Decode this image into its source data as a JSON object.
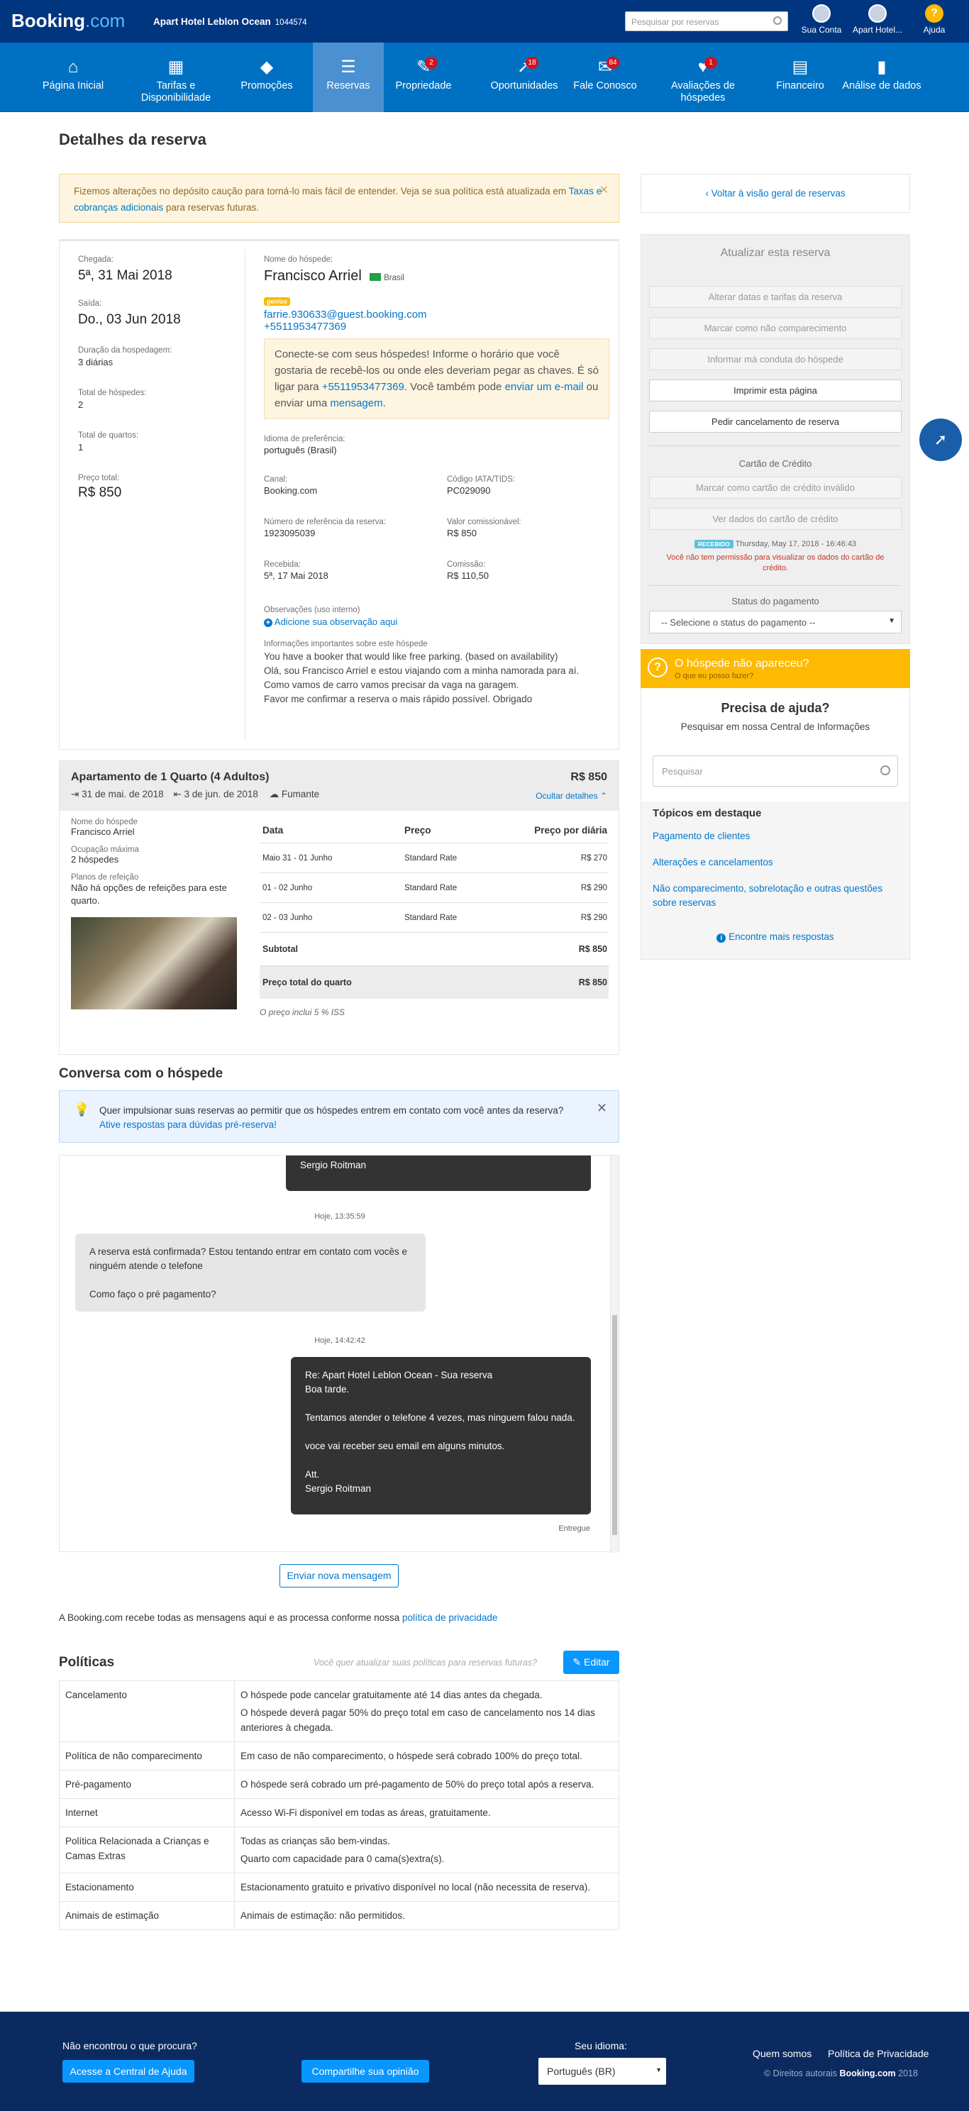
{
  "header": {
    "logo_main": "Booking",
    "logo_suffix": ".com",
    "hotel_name": "Apart Hotel Leblon Ocean",
    "hotel_id": "1044574",
    "search_placeholder": "Pesquisar por reservas",
    "account_label": "Sua Conta",
    "property_label": "Apart Hotel...",
    "help_label": "Ajuda"
  },
  "nav": [
    {
      "label": "Página Inicial",
      "icon": "home-icon",
      "badge": ""
    },
    {
      "label": "Tarifas e Disponibilidade",
      "icon": "calendar-icon",
      "badge": ""
    },
    {
      "label": "Promoções",
      "icon": "tag-icon",
      "badge": ""
    },
    {
      "label": "Reservas",
      "icon": "list-icon",
      "badge": ""
    },
    {
      "label": "Propriedade",
      "icon": "pen-icon",
      "badge": "2"
    },
    {
      "label": "Oportunidades",
      "icon": "rocket-icon",
      "badge": "18"
    },
    {
      "label": "Fale Conosco",
      "icon": "envelope-icon",
      "badge": "84"
    },
    {
      "label": "Avaliações de hóspedes",
      "icon": "heart-icon",
      "badge": "1"
    },
    {
      "label": "Financeiro",
      "icon": "document-icon",
      "badge": ""
    },
    {
      "label": "Análise de dados",
      "icon": "chart-icon",
      "badge": ""
    }
  ],
  "page": {
    "title": "Detalhes da reserva"
  },
  "alert": {
    "text1": "Fizemos alterações no depósito caução para torná-lo mais fácil de entender. Veja se sua política está atualizada em ",
    "link": "Taxas e cobranças adicionais",
    "text2": " para reservas futuras."
  },
  "summary": {
    "checkin_label": "Chegada:",
    "checkin": "5ª, 31 Mai 2018",
    "checkout_label": "Saída:",
    "checkout": "Do., 03 Jun 2018",
    "duration_label": "Duração da hospedagem:",
    "duration": "3 diárias",
    "guests_label": "Total de hóspedes:",
    "guests": "2",
    "rooms_label": "Total de quartos:",
    "rooms": "1",
    "price_label": "Preço total:",
    "price": "R$ 850"
  },
  "guest": {
    "name_label": "Nome do hóspede:",
    "name": "Francisco Arriel",
    "country": "Brasil",
    "genius": "genius",
    "email": "farrie.930633@guest.booking.com",
    "phone": "+5511953477369",
    "note_text1": "Conecte-se com seus hóspedes! Informe o horário que você gostaria de recebê-los ou onde eles deveriam pegar as chaves. É só ligar para ",
    "note_phone": "+5511953477369",
    "note_text2": ". Você também pode ",
    "note_email": "enviar um e-mail",
    "note_text3": " ou enviar uma ",
    "note_msg": "mensagem",
    "note_text4": ".",
    "lang_label": "Idioma de preferência:",
    "lang": "português (Brasil)",
    "channel_label": "Canal:",
    "channel": "Booking.com",
    "iata_label": "Código IATA/TIDS:",
    "iata": "PC029090",
    "ref_label": "Número de referência da reserva:",
    "ref": "1923095039",
    "commission_value_label": "Valor comissionável:",
    "commission_value": "R$ 850",
    "received_label": "Recebida:",
    "received": "5ª, 17 Mai 2018",
    "commission_label": "Comissão:",
    "commission": "R$ 110,50",
    "obs_label": "Observações (uso interno)",
    "obs_add": "Adicione sua observação aqui",
    "info_label": "Informações importantes sobre este hóspede",
    "info_lines": [
      "You have a booker that would like free parking. (based on availability)",
      "Olá, sou Francisco Arriel e estou viajando com a minha namorada para aí.",
      "Como vamos de carro vamos precisar da vaga na garagem.",
      "Favor me confirmar a reserva o mais rápido possível. Obrigado"
    ]
  },
  "room": {
    "title": "Apartamento de 1 Quarto (4 Adultos)",
    "price": "R$ 850",
    "checkin": "31 de mai. de 2018",
    "checkout": "3 de jun. de 2018",
    "smoking": "Fumante",
    "hide_details": "Ocultar detalhes",
    "guest_label": "Nome do hóspede",
    "guest": "Francisco Arriel",
    "occupancy_label": "Ocupação máxima",
    "occupancy": "2 hóspedes",
    "meal_label": "Planos de refeição",
    "meal": "Não há opções de refeições para este quarto.",
    "cols": [
      "Data",
      "Preço",
      "Preço por diária"
    ],
    "rows": [
      [
        "Maio 31 - 01 Junho",
        "Standard Rate",
        "R$ 270"
      ],
      [
        "01 - 02 Junho",
        "Standard Rate",
        "R$ 290"
      ],
      [
        "02 - 03 Junho",
        "Standard Rate",
        "R$ 290"
      ]
    ],
    "subtotal_label": "Subtotal",
    "subtotal": "R$ 850",
    "total_label": "Preço total do quarto",
    "total": "R$ 850",
    "tax_note": "O preço inclui 5 % ISS"
  },
  "chat": {
    "title": "Conversa com o hóspede",
    "tip": "Quer impulsionar suas reservas ao permitir que os hóspedes entrem em contato com você antes da reserva?",
    "tip_link": "Ative respostas para dúvidas pré-reserva!",
    "m0_sig": "Sergio Roitman",
    "t1": "Hoje, 13:35:59",
    "m1_lines": [
      "A reserva está confirmada? Estou tentando entrar em contato com vocês e ninguém atende o telefone",
      "",
      "Como faço o pré pagamento?"
    ],
    "t2": "Hoje, 14:42:42",
    "m2_lines": [
      "Re: Apart Hotel Leblon Ocean - Sua reserva",
      "Boa tarde.",
      "",
      "Tentamos atender o telefone 4 vezes, mas ninguem falou nada.",
      "",
      "voce vai receber seu email em alguns minutos.",
      "",
      "Att.",
      "Sergio Roitman"
    ],
    "delivered": "Entregue",
    "new_msg": "Enviar nova mensagem",
    "privacy_text": "A Booking.com recebe todas as mensagens aqui e as processa conforme nossa ",
    "privacy_link": "política de privacidade"
  },
  "policies": {
    "title": "Políticas",
    "update_q": "Você quer atualizar suas políticas para reservas futuras?",
    "edit": "Editar",
    "rows": [
      [
        "Cancelamento",
        "O hóspede pode cancelar gratuitamente até 14 dias antes da chegada.",
        "O hóspede deverá pagar 50% do preço total em caso de cancelamento nos 14 dias anteriores à chegada."
      ],
      [
        "Política de não comparecimento",
        "Em caso de não comparecimento, o hóspede será cobrado 100% do preço total.",
        ""
      ],
      [
        "Pré-pagamento",
        "O hóspede será cobrado um pré-pagamento de 50% do preço total após a reserva.",
        ""
      ],
      [
        "Internet",
        "Acesso Wi-Fi disponível em todas as áreas, gratuitamente.",
        ""
      ],
      [
        "Política Relacionada a Crianças e Camas Extras",
        "Todas as crianças são bem-vindas.",
        "Quarto com capacidade para 0 cama(s)extra(s)."
      ],
      [
        "Estacionamento",
        "Estacionamento gratuito e privativo disponível no local (não necessita de reserva).",
        ""
      ],
      [
        "Animais de estimação",
        "Animais de estimação: não permitidos.",
        ""
      ]
    ]
  },
  "sidebar": {
    "back": "Voltar à visão geral de reservas",
    "update_title": "Atualizar esta reserva",
    "btn_change": "Alterar datas e tarifas da reserva",
    "btn_noshow": "Marcar como não comparecimento",
    "btn_misconduct": "Informar má conduta do hóspede",
    "btn_print": "Imprimir esta página",
    "btn_cancel": "Pedir cancelamento de reserva",
    "card_title": "Cartão de Crédito",
    "btn_invalid": "Marcar como cartão de crédito inválido",
    "btn_view_card": "Ver dados do cartão de crédito",
    "received_badge": "RECEBIDO",
    "received_date": "Thursday, May 17, 2018 - 16:46:43",
    "no_permission": "Você não tem permissão para visualizar os dados do cartão de crédito.",
    "payment_title": "Status do pagamento",
    "payment_select": "-- Selecione o status do pagamento --",
    "noshow_title": "O hóspede não apareceu?",
    "noshow_sub": "O que eu posso fazer?",
    "help_title": "Precisa de ajuda?",
    "help_sub": "Pesquisar em nossa Central de Informações",
    "help_search": "Pesquisar",
    "topics_title": "Tópicos em destaque",
    "topics": [
      "Pagamento de clientes",
      "Alterações e cancelamentos",
      "Não comparecimento, sobrelotação e outras questões sobre reservas"
    ],
    "more": "Encontre mais respostas"
  },
  "footer": {
    "question": "Não encontrou o que procura?",
    "help_btn": "Acesse a Central de Ajuda",
    "share_btn": "Compartilhe sua opinião",
    "lang_label": "Seu idioma:",
    "lang_value": "Português (BR)",
    "about": "Quem somos",
    "privacy": "Política de Privacidade",
    "copyright": "© Direitos autorais ",
    "copyright_brand": "Booking.com",
    "copyright_year": " 2018"
  },
  "colors": {
    "dark_blue": "#003580",
    "nav_blue": "#0071c2",
    "active_blue": "#4b90d0",
    "link": "#0077cc",
    "yellow": "#feba02",
    "badge_red": "#d4111e"
  }
}
